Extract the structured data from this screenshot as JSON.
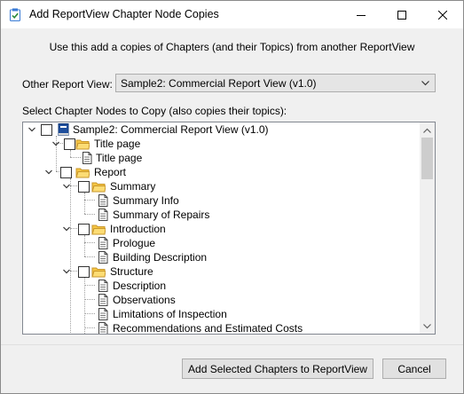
{
  "window": {
    "title": "Add ReportView Chapter Node Copies",
    "icons": {
      "app": "clipboard-check-icon",
      "minimize": "minimize-icon",
      "maximize": "maximize-icon",
      "close": "close-icon"
    }
  },
  "intro_text": "Use this add a copies of Chapters (and their Topics) from another ReportView",
  "other_view": {
    "label": "Other Report View:",
    "selected": "Sample2: Commercial Report View (v1.0)"
  },
  "tree_label": "Select Chapter Nodes to Copy (also copies their topics):",
  "tree": {
    "root": "Sample2: Commercial Report View (v1.0)",
    "nodes": [
      {
        "label": "Title page",
        "type": "folder"
      },
      {
        "label": "Title page",
        "type": "topic"
      },
      {
        "label": "Report",
        "type": "folder"
      },
      {
        "label": "Summary",
        "type": "folder"
      },
      {
        "label": "Summary Info",
        "type": "topic"
      },
      {
        "label": "Summary of Repairs",
        "type": "topic"
      },
      {
        "label": "Introduction",
        "type": "folder"
      },
      {
        "label": "Prologue",
        "type": "topic"
      },
      {
        "label": "Building Description",
        "type": "topic"
      },
      {
        "label": "Structure",
        "type": "folder"
      },
      {
        "label": "Description",
        "type": "topic"
      },
      {
        "label": "Observations",
        "type": "topic"
      },
      {
        "label": "Limitations of Inspection",
        "type": "topic"
      },
      {
        "label": "Recommendations and Estimated Costs",
        "type": "topic"
      }
    ]
  },
  "buttons": {
    "add": "Add Selected Chapters to ReportView",
    "cancel": "Cancel"
  },
  "colors": {
    "folder": "#f5c542",
    "book": "#1e4e9c",
    "button_face": "#e1e1e1"
  }
}
